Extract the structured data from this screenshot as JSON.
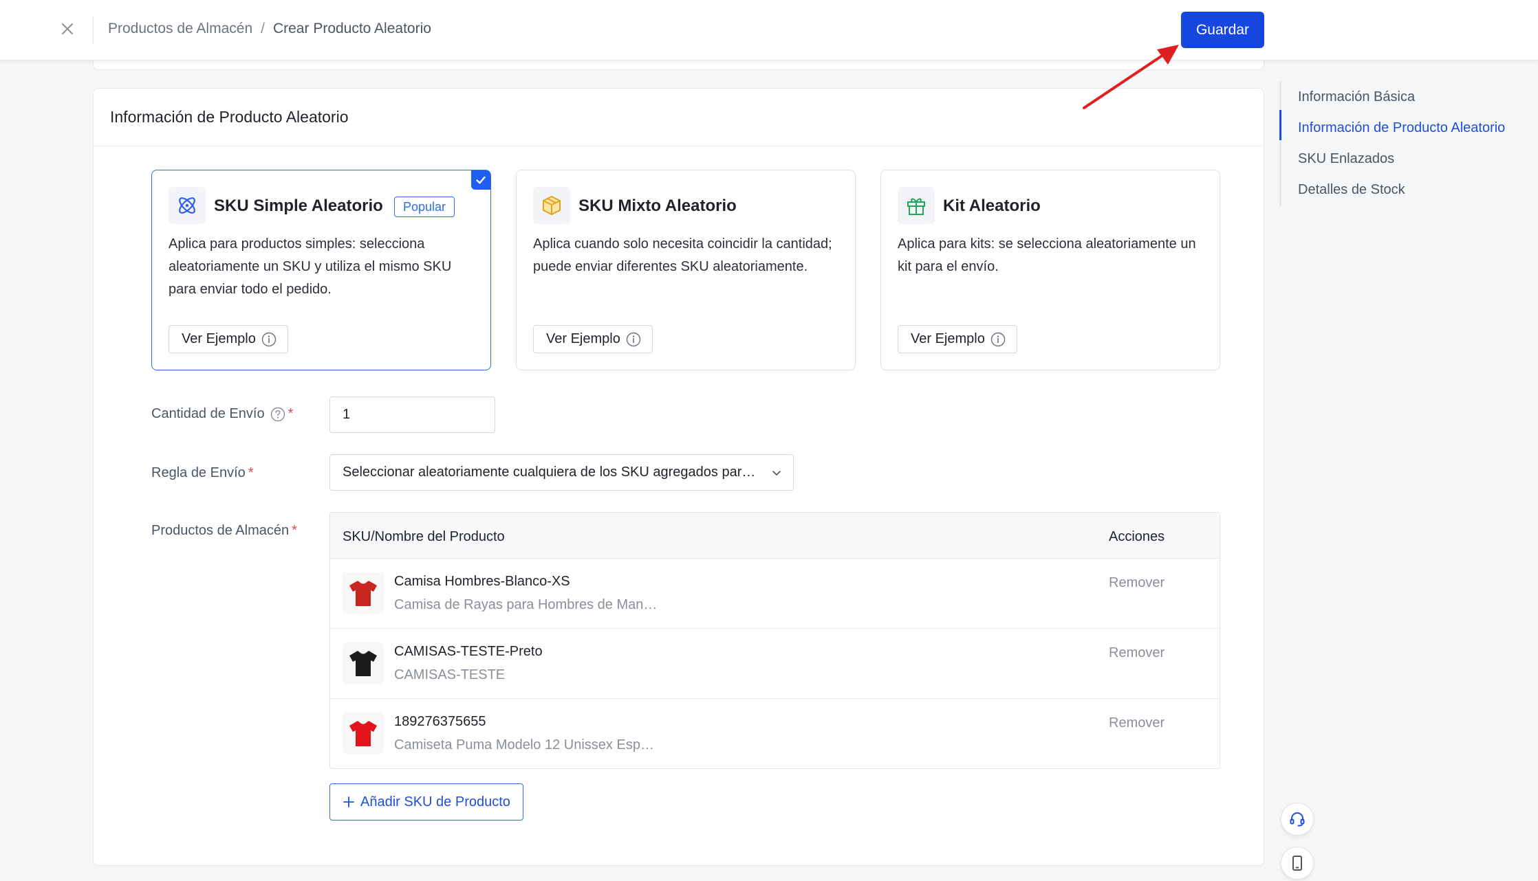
{
  "header": {
    "breadcrumb": [
      "Productos de Almacén",
      "Crear Producto Aleatorio"
    ],
    "separator": "/",
    "save_label": "Guardar"
  },
  "section": {
    "title": "Información de Producto Aleatorio"
  },
  "type_cards": [
    {
      "title": "SKU Simple Aleatorio",
      "badge": "Popular",
      "description": "Aplica para productos simples: selecciona aleatoriamente un SKU y utiliza el mismo SKU para enviar todo el pedido.",
      "button": "Ver Ejemplo",
      "selected": true,
      "icon": "atom-icon"
    },
    {
      "title": "SKU Mixto Aleatorio",
      "description": "Aplica cuando solo necesita coincidir la cantidad; puede enviar diferentes SKU aleatoriamente.",
      "button": "Ver Ejemplo",
      "selected": false,
      "icon": "box-icon"
    },
    {
      "title": "Kit Aleatorio",
      "description": "Aplica para kits: se selecciona aleatoriamente un kit para el envío.",
      "button": "Ver Ejemplo",
      "selected": false,
      "icon": "gift-icon"
    }
  ],
  "form": {
    "quantity_label": "Cantidad de Envío",
    "quantity_value": "1",
    "rule_label": "Regla de Envío",
    "rule_value": "Seleccionar aleatoriamente cualquiera de los SKU agregados para el envío",
    "products_label": "Productos de Almacén",
    "required_mark": "*"
  },
  "table": {
    "columns": [
      "SKU/Nombre del Producto",
      "Acciones"
    ],
    "rows": [
      {
        "sku": "Camisa Hombres-Blanco-XS",
        "name": "Camisa de Rayas para Hombres de Man…",
        "action": "Remover",
        "shirt_color": "#c8261e"
      },
      {
        "sku": "CAMISAS-TESTE-Preto",
        "name": "CAMISAS-TESTE",
        "action": "Remover",
        "shirt_color": "#1c1c1c"
      },
      {
        "sku": "189276375655",
        "name": "Camiseta Puma Modelo 12 Unissex Esp…",
        "action": "Remover",
        "shirt_color": "#e2131b"
      }
    ]
  },
  "add_sku_label": "Añadir SKU de Producto",
  "side_nav": {
    "items": [
      "Información Básica",
      "Información de Producto Aleatorio",
      "SKU Enlazados",
      "Detalles de Stock"
    ],
    "active_index": 1
  },
  "colors": {
    "primary": "#1647e0",
    "annotation_arrow": "#e02020",
    "required": "#e5484d"
  }
}
